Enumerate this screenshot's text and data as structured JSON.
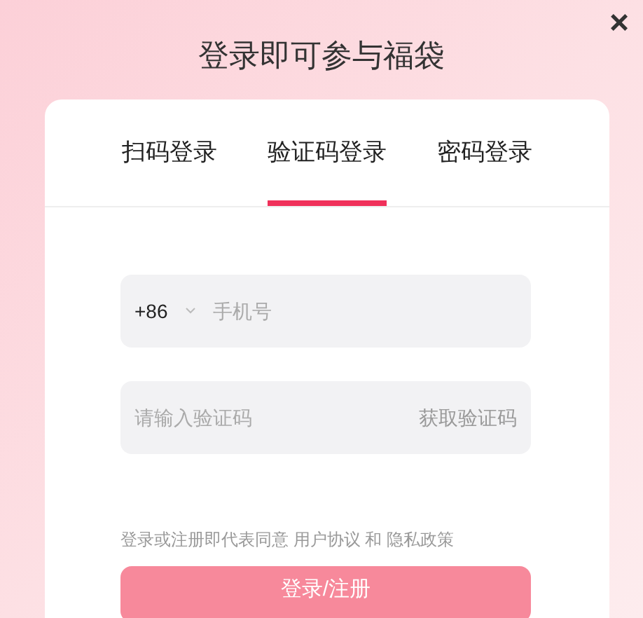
{
  "title": "登录即可参与福袋",
  "close": "×",
  "tabs": [
    {
      "label": "扫码登录",
      "selected": false
    },
    {
      "label": "验证码登录",
      "selected": true
    },
    {
      "label": "密码登录",
      "selected": false
    }
  ],
  "phone_field": {
    "country_code": "+86",
    "placeholder": "手机号"
  },
  "code_field": {
    "placeholder": "请输入验证码",
    "action": "获取验证码"
  },
  "agreement": {
    "text": "登录或注册即代表同意",
    "links": [
      "用户协议",
      "隐私政策"
    ],
    "joiner": "和"
  },
  "submit_button": "登录/注册"
}
